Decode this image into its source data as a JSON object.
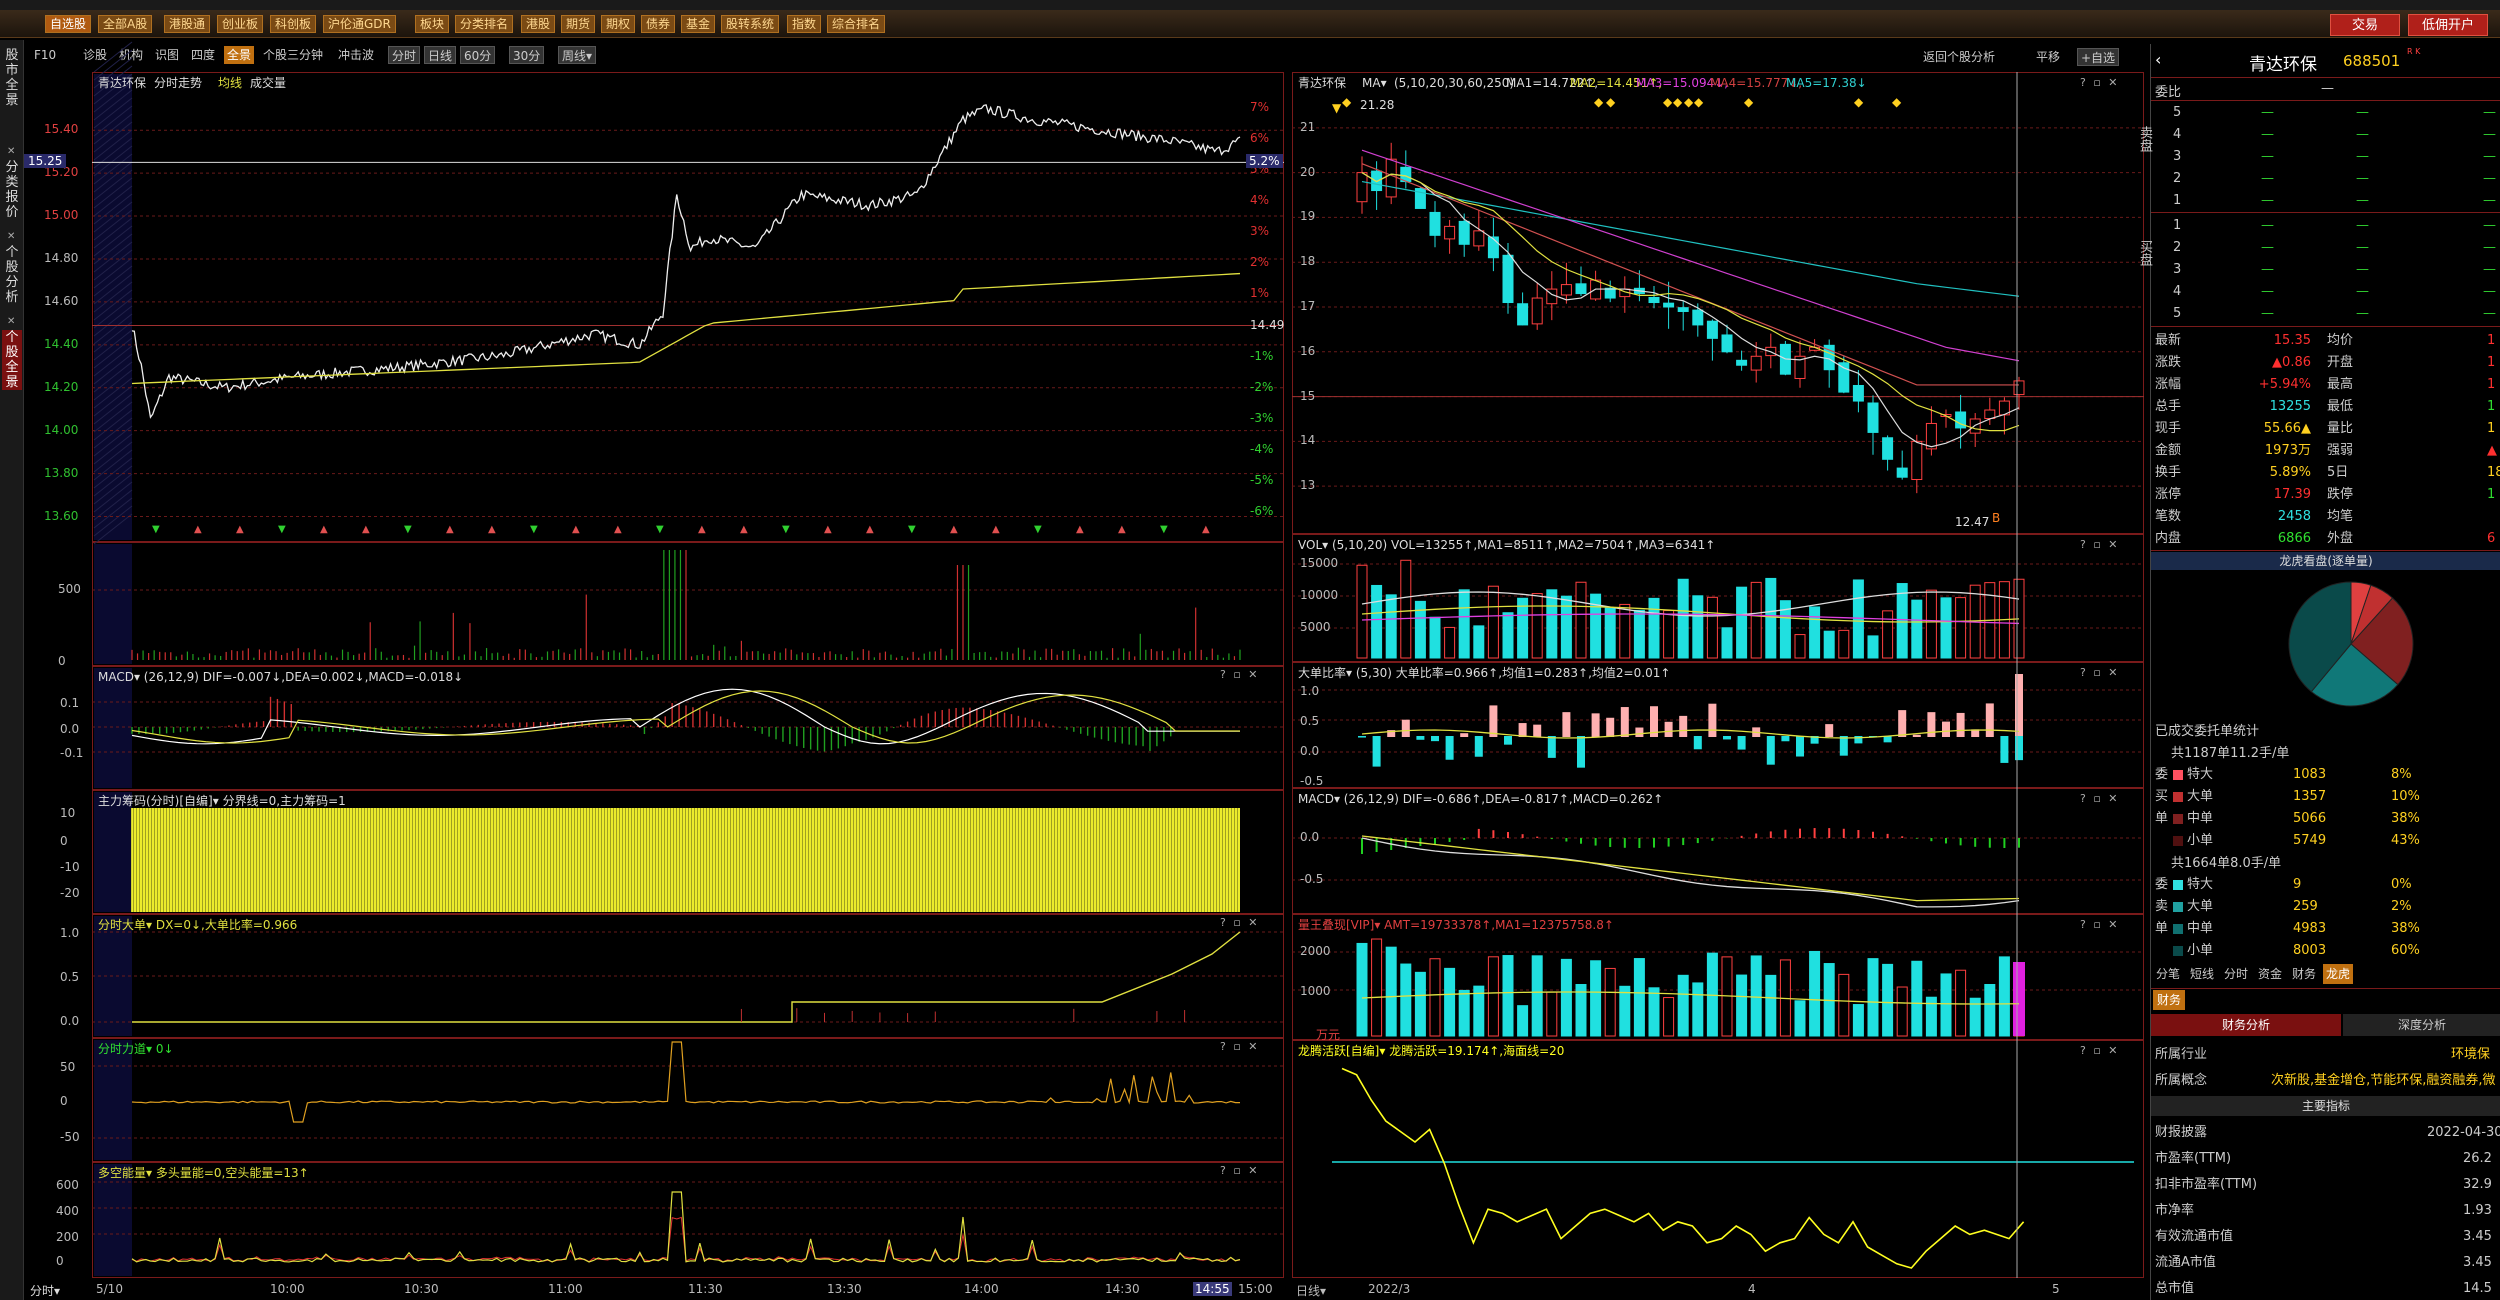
{
  "toolbar": {
    "buttons": [
      "自选股",
      "全部A股",
      "港股通",
      "创业板",
      "科创板",
      "沪伦通GDR",
      "板块",
      "分类排名",
      "港股",
      "期货",
      "期权",
      "债券",
      "基金",
      "股转系统",
      "指数",
      "综合排名"
    ],
    "trade": "交易",
    "open_account": "低佣开户"
  },
  "leftnav": [
    {
      "label": "股市全景"
    },
    {
      "label": "分类报价"
    },
    {
      "label": "个股分析"
    },
    {
      "label": "个股全景"
    }
  ],
  "subtabs": {
    "items": [
      "F10",
      "诊股",
      "机构",
      "识图",
      "四度",
      "全景",
      "个股三分钟",
      "冲击波"
    ],
    "period_group": [
      "分时",
      "日线",
      "60分",
      "30分",
      "周线▾"
    ],
    "right": [
      "返回个股分析",
      "平移",
      "+自选"
    ]
  },
  "intraday": {
    "header": [
      "青达环保",
      "分时走势",
      "均线",
      "成交量"
    ],
    "price_label": "15.25",
    "pct_label": "5.2%",
    "prev_close": "14.49",
    "y_left": [
      "15.40",
      "15.20",
      "15.00",
      "14.80",
      "14.60",
      "14.40",
      "14.20",
      "14.00",
      "13.80",
      "13.60"
    ],
    "y_right": [
      "7%",
      "6%",
      "5%",
      "4%",
      "3%",
      "2%",
      "1%",
      "-1%",
      "-2%",
      "-3%",
      "-4%",
      "-5%",
      "-6%"
    ],
    "vol_ticks": [
      "500",
      "0"
    ],
    "macd_header": "MACD▾ (26,12,9) DIF=-0.007↓,DEA=0.002↓,MACD=-0.018↓",
    "macd_ticks": [
      "0.1",
      "0.0",
      "-0.1"
    ],
    "main_chip_header": "主力筹码(分时)[自编]▾ 分界线=0,主力筹码=1",
    "chip_ticks": [
      "10",
      "0",
      "-10",
      "-20"
    ],
    "big_order_header": "分时大单▾ DX=0↓,大单比率=0.966",
    "big_ticks": [
      "1.0",
      "0.5",
      "0.0"
    ],
    "force_header": "分时力道▾ 0↓",
    "force_ticks": [
      "50",
      "0",
      "-50"
    ],
    "energy_header": "多空能量▾ 多头量能=0,空头能量=13↑",
    "energy_ticks": [
      "600",
      "400",
      "200",
      "0"
    ],
    "time_axis": [
      "分时▾",
      "5/10",
      "10:00",
      "10:30",
      "11:00",
      "11:30",
      "13:30",
      "14:00",
      "14:30",
      "14:55",
      "15:00"
    ]
  },
  "daily": {
    "header": [
      "青达环保",
      "MA▾",
      "(5,10,20,30,60,250)",
      "MA1=14.722↑,",
      "MA2=14.451↑,",
      "MA3=15.094↓,",
      "MA4=15.777↓,",
      "MA5=17.38↓"
    ],
    "high_label": "21.28",
    "low_label": "12.47",
    "y": [
      "21",
      "20",
      "19",
      "18",
      "17",
      "16",
      "15",
      "14",
      "13"
    ],
    "vol_header": "VOL▾ (5,10,20) VOL=13255↑,MA1=8511↑,MA2=7504↑,MA3=6341↑",
    "vol_ticks": [
      "15000",
      "10000",
      "5000"
    ],
    "big_header": "大单比率▾ (5,30) 大单比率=0.966↑,均值1=0.283↑,均值2=0.01↑",
    "big_ticks": [
      "1.0",
      "0.5",
      "0.0",
      "-0.5"
    ],
    "macd_header": "MACD▾ (26,12,9) DIF=-0.686↑,DEA=-0.817↑,MACD=0.262↑",
    "macd_ticks": [
      "0.0",
      "-0.5"
    ],
    "amt_header": "量王叠现[VIP]▾ AMT=19733378↑,MA1=12375758.8↑",
    "amt_ticks": [
      "2000",
      "1000"
    ],
    "amt_unit": "万元",
    "dragon_header": "龙腾活跃[自编]▾ 龙腾活跃=19.174↑,海面线=20",
    "time_axis": [
      "日线▾",
      "2022/3",
      "4",
      "5"
    ]
  },
  "quote": {
    "name": "青达环保",
    "code": "688501",
    "weibi": "委比",
    "dash": "—",
    "sell": [
      {
        "level": "5"
      },
      {
        "level": "4"
      },
      {
        "level": "3"
      },
      {
        "level": "2"
      },
      {
        "level": "1"
      }
    ],
    "buy": [
      {
        "level": "1"
      },
      {
        "level": "2"
      },
      {
        "level": "3"
      },
      {
        "level": "4"
      },
      {
        "level": "5"
      }
    ],
    "sell_label": "卖盘",
    "buy_label": "买盘",
    "stats": [
      {
        "l1": "最新",
        "v1": "15.35",
        "c1": "#ff3030",
        "l2": "均价",
        "v2": "1",
        "c2": "#ff3030"
      },
      {
        "l1": "涨跌",
        "v1": "▲0.86",
        "c1": "#ff3030",
        "l2": "开盘",
        "v2": "1",
        "c2": "#ff3030"
      },
      {
        "l1": "涨幅",
        "v1": "+5.94%",
        "c1": "#ff3030",
        "l2": "最高",
        "v2": "1",
        "c2": "#ff3030"
      },
      {
        "l1": "总手",
        "v1": "13255",
        "c1": "#30e0e0",
        "l2": "最低",
        "v2": "1",
        "c2": "#30e030"
      },
      {
        "l1": "现手",
        "v1": "55.66▲",
        "c1": "#ffd020",
        "l2": "量比",
        "v2": "1",
        "c2": "#ffd020"
      },
      {
        "l1": "金额",
        "v1": "1973万",
        "c1": "#ffd020",
        "l2": "强弱",
        "v2": "▲",
        "c2": "#ff3030"
      },
      {
        "l1": "换手",
        "v1": "5.89%",
        "c1": "#ffd020",
        "l2": "5日",
        "v2": "18.",
        "c2": "#ffd020"
      },
      {
        "l1": "涨停",
        "v1": "17.39",
        "c1": "#ff3030",
        "l2": "跌停",
        "v2": "1",
        "c2": "#30e030"
      },
      {
        "l1": "笔数",
        "v1": "2458",
        "c1": "#30e0e0",
        "l2": "均笔",
        "v2": "",
        "c2": "#ffd020"
      },
      {
        "l1": "内盘",
        "v1": "6866",
        "c1": "#30e030",
        "l2": "外盘",
        "v2": "6",
        "c2": "#ff3030"
      }
    ],
    "lh_title": "龙虎看盘(逐单量)",
    "pie": [
      {
        "name": "特大",
        "value": 8,
        "color": "#e04040"
      },
      {
        "name": "大单",
        "value": 10,
        "color": "#b03030"
      },
      {
        "name": "中单",
        "value": 38,
        "color": "#7a1a1a"
      },
      {
        "name": "小单",
        "value": 43,
        "color": "#1a3a3a"
      },
      {
        "name": "卖中单",
        "value": 38,
        "color": "#108080"
      }
    ],
    "pie_chart": {
      "type": "pie",
      "slices": [
        {
          "label": "买特大",
          "value": 8,
          "color": "#e04040"
        },
        {
          "label": "买大单",
          "value": 10,
          "color": "#c03030"
        },
        {
          "label": "买中单",
          "value": 38,
          "color": "#802020"
        },
        {
          "label": "卖中单",
          "value": 38,
          "color": "#107878"
        },
        {
          "label": "卖小单",
          "value": 60,
          "color": "#0a4a4a"
        }
      ]
    },
    "trade_stats_title": "已成交委托单统计",
    "buy_total": "共1187单11.2手/单",
    "sell_total": "共1664单8.0手/单",
    "buy_rows": [
      {
        "side": "委",
        "name": "特大",
        "n": "1083",
        "p": "8%",
        "color": "#ff5060"
      },
      {
        "side": "买",
        "name": "大单",
        "n": "1357",
        "p": "10%",
        "color": "#c03030"
      },
      {
        "side": "单",
        "name": "中单",
        "n": "5066",
        "p": "38%",
        "color": "#802020"
      },
      {
        "side": "",
        "name": "小单",
        "n": "5749",
        "p": "43%",
        "color": "#501010"
      }
    ],
    "sell_rows": [
      {
        "side": "委",
        "name": "特大",
        "n": "9",
        "p": "0%",
        "color": "#30e0e0"
      },
      {
        "side": "卖",
        "name": "大单",
        "n": "259",
        "p": "2%",
        "color": "#20a0a0"
      },
      {
        "side": "单",
        "name": "中单",
        "n": "4983",
        "p": "38%",
        "color": "#107070"
      },
      {
        "side": "",
        "name": "小单",
        "n": "8003",
        "p": "60%",
        "color": "#0a4a4a"
      }
    ],
    "tabs": [
      "分笔",
      "短线",
      "分时",
      "资金",
      "财务",
      "龙虎"
    ],
    "fin_tab": "财务",
    "fin_sub": [
      "财务分析",
      "深度分析"
    ],
    "info": [
      {
        "l": "所属行业",
        "v": "环境保"
      },
      {
        "l": "所属概念",
        "v": "次新股,基金增仓,节能环保,融资融券,微"
      }
    ],
    "main_idx": "主要指标",
    "fin": [
      {
        "l": "财报披露",
        "v": "2022-04-30"
      },
      {
        "l": "市盈率(TTM)",
        "v": "26.2"
      },
      {
        "l": "扣非市盈率(TTM)",
        "v": "32.9"
      },
      {
        "l": "市净率",
        "v": "1.93"
      },
      {
        "l": "有效流通市值",
        "v": "3.45"
      },
      {
        "l": "流通A市值",
        "v": "3.45"
      },
      {
        "l": "总市值",
        "v": "14.5"
      }
    ]
  }
}
